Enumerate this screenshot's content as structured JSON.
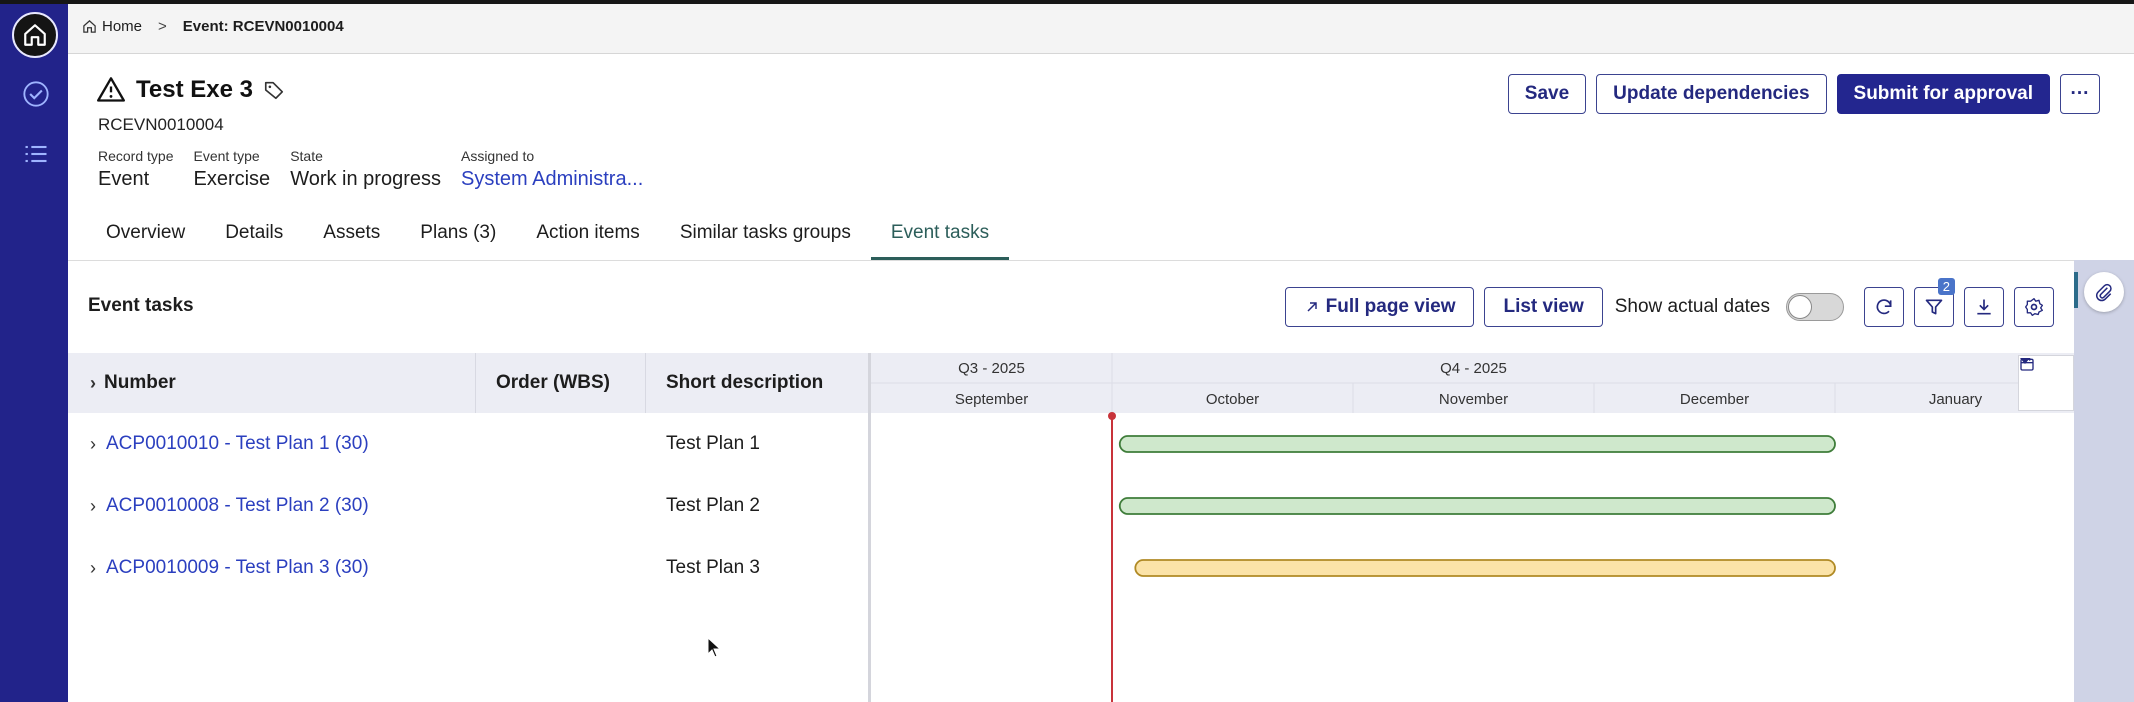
{
  "breadcrumb": {
    "home": "Home",
    "separator": ">",
    "current": "Event: RCEVN0010004"
  },
  "record": {
    "title": "Test Exe 3",
    "number": "RCEVN0010004",
    "fields": [
      {
        "label": "Record type",
        "value": "Event"
      },
      {
        "label": "Event type",
        "value": "Exercise"
      },
      {
        "label": "State",
        "value": "Work in progress"
      },
      {
        "label": "Assigned to",
        "value": "System Administra..."
      }
    ]
  },
  "actions": {
    "save": "Save",
    "update": "Update dependencies",
    "submit": "Submit for approval",
    "more": "···"
  },
  "tabs": [
    "Overview",
    "Details",
    "Assets",
    "Plans (3)",
    "Action items",
    "Similar tasks groups",
    "Event tasks"
  ],
  "active_tab": "Event tasks",
  "panel": {
    "title": "Event tasks",
    "full_page": "Full page view",
    "list_view": "List view",
    "show_actual": "Show actual dates",
    "filter_count": "2"
  },
  "grid": {
    "columns": [
      "Number",
      "Order (WBS)",
      "Short description"
    ],
    "rows": [
      {
        "number": "ACP0010010 - Test Plan 1 (30)",
        "order": "",
        "desc": "Test Plan 1"
      },
      {
        "number": "ACP0010008 - Test Plan 2 (30)",
        "order": "",
        "desc": "Test Plan 2"
      },
      {
        "number": "ACP0010009 - Test Plan 3 (30)",
        "order": "",
        "desc": "Test Plan 3"
      }
    ]
  },
  "timeline": {
    "quarters": [
      "Q3 - 2025",
      "Q4 - 2025"
    ],
    "months": [
      "September",
      "October",
      "November",
      "December",
      "January"
    ],
    "today": "2025-10-01",
    "bars": [
      {
        "start": "2025-10-02",
        "end": "2026-01-01",
        "color": "#cfe8cc",
        "stroke": "#3f7d3a"
      },
      {
        "start": "2025-10-02",
        "end": "2026-01-01",
        "color": "#cfe8cc",
        "stroke": "#3f7d3a"
      },
      {
        "start": "2025-10-04",
        "end": "2026-01-01",
        "color": "#fbe3a8",
        "stroke": "#b08a25"
      }
    ]
  },
  "colors": {
    "rail": "#22238a",
    "primary": "#23268f",
    "link": "#2b3fbf",
    "today_line": "#c8333a",
    "tab_active": "#2c5e5a"
  }
}
